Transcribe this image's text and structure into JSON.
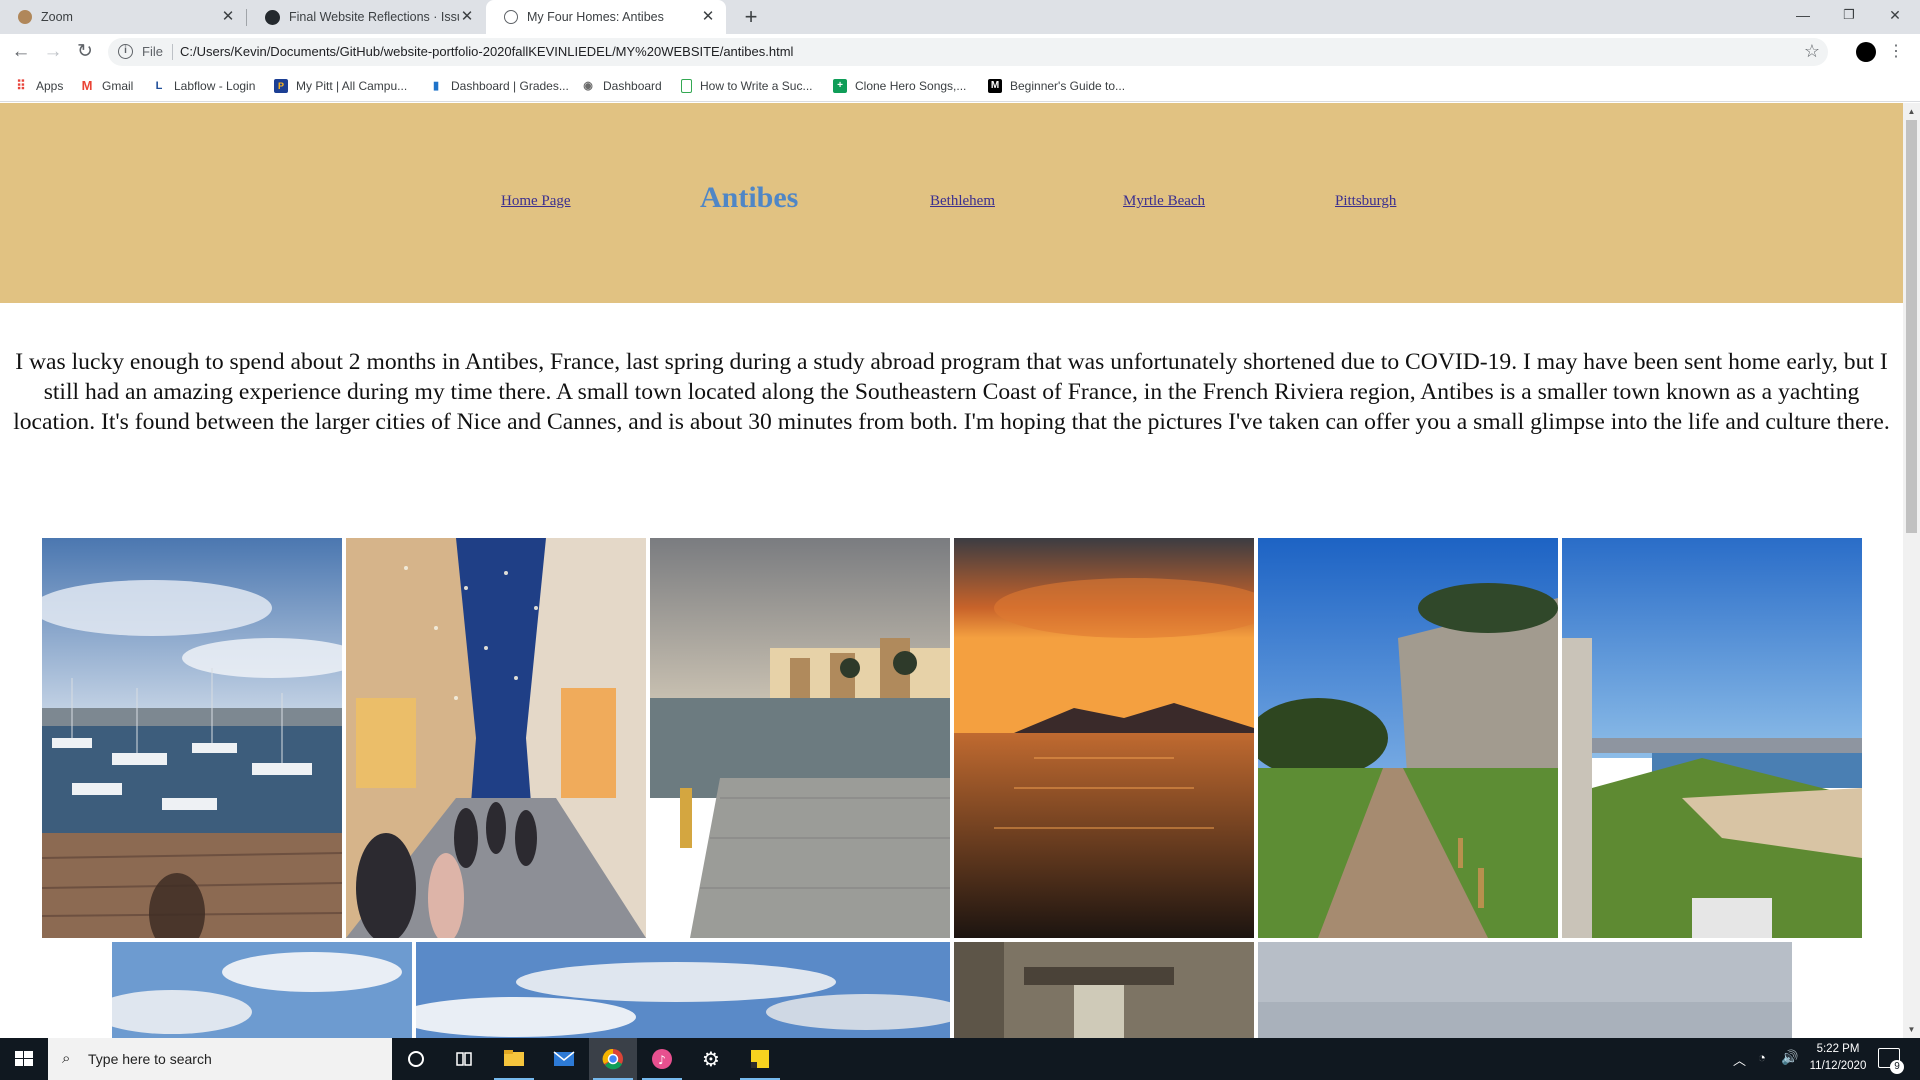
{
  "browser": {
    "tabs": [
      {
        "title": "Zoom",
        "icon": "zoom-tab-icon"
      },
      {
        "title": "Final Website Reflections · Issue #",
        "icon": "github-icon"
      },
      {
        "title": "My Four Homes: Antibes",
        "icon": "globe-icon"
      }
    ],
    "address": {
      "scheme": "File",
      "url": "C:/Users/Kevin/Documents/GitHub/website-portfolio-2020fallKEVINLIEDEL/MY%20WEBSITE/antibes.html"
    },
    "bookmarks": [
      {
        "label": "Apps",
        "icon": "apps-grid-icon"
      },
      {
        "label": "Gmail",
        "icon": "gmail-icon"
      },
      {
        "label": "Labflow - Login",
        "icon": "labflow-icon"
      },
      {
        "label": "My Pitt | All Campu...",
        "icon": "pitt-icon"
      },
      {
        "label": "Dashboard | Grades...",
        "icon": "dashboard-chart-icon"
      },
      {
        "label": "Dashboard",
        "icon": "dashboard-shield-icon"
      },
      {
        "label": "How to Write a Suc...",
        "icon": "doc-icon"
      },
      {
        "label": "Clone Hero Songs,...",
        "icon": "sheets-icon"
      },
      {
        "label": "Beginner's Guide to...",
        "icon": "medium-icon"
      }
    ]
  },
  "page": {
    "nav": {
      "home": "Home Page",
      "current": "Antibes",
      "bethlehem": "Bethlehem",
      "myrtle": "Myrtle Beach",
      "pittsburgh": "Pittsburgh"
    },
    "intro": "I was lucky enough to spend about 2 months in Antibes, France, last spring during a study abroad program that was unfortunately shortened due to COVID-19. I may have been sent home early, but I still had an amazing experience during my time there. A small town located along the Southeastern Coast of France, in the French Riviera region, Antibes is a smaller town known as a yachting location. It's found between the larger cities of Nice and Cannes, and is about 30 minutes from both. I'm hoping that the pictures I've taken can offer you a small glimpse into the life and culture there.",
    "photos": [
      {
        "subject": "marina-harbor"
      },
      {
        "subject": "night-street-lights"
      },
      {
        "subject": "seafront-dock"
      },
      {
        "subject": "sunset-over-sea"
      },
      {
        "subject": "fort-dirt-path"
      },
      {
        "subject": "rampart-coast"
      },
      {
        "subject": "cloudy-sky"
      },
      {
        "subject": "sky-clouds-wide"
      },
      {
        "subject": "narrow-alley"
      },
      {
        "subject": "hazy-sea"
      }
    ]
  },
  "taskbar": {
    "search_placeholder": "Type here to search",
    "time": "5:22 PM",
    "date": "11/12/2020",
    "notification_count": "9"
  }
}
